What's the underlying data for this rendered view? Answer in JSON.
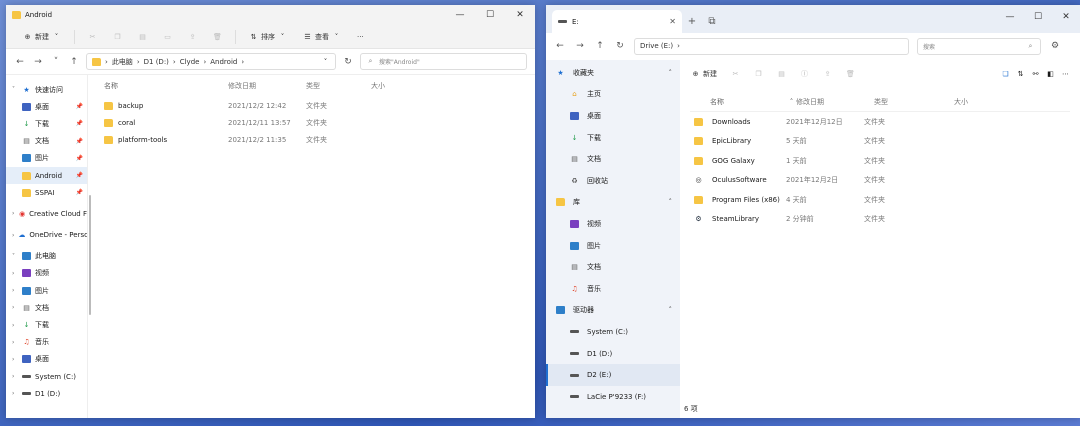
{
  "colors": {
    "accent": "#1f6fd1",
    "folder": "#f6c544",
    "desktop": "#3f63c0"
  },
  "left": {
    "title": "Android",
    "commands": {
      "new": "新建",
      "sort": "排序",
      "view": "查看",
      "more": "···"
    },
    "breadcrumb": [
      "此电脑",
      "D1 (D:)",
      "Clyde",
      "Android"
    ],
    "search_placeholder": "搜索\"Android\"",
    "columns": {
      "name": "名称",
      "date": "修改日期",
      "type": "类型",
      "size": "大小"
    },
    "files": [
      {
        "name": "backup",
        "date": "2021/12/2 12:42",
        "type": "文件夹"
      },
      {
        "name": "coral",
        "date": "2021/12/11 13:57",
        "type": "文件夹"
      },
      {
        "name": "platform-tools",
        "date": "2021/12/2 11:35",
        "type": "文件夹"
      }
    ],
    "nav": [
      {
        "label": "快速访问",
        "icon": "star-icon",
        "chev": "˅",
        "pin": ""
      },
      {
        "label": "桌面",
        "icon": "desktop-icon",
        "chev": "",
        "pin": "📌"
      },
      {
        "label": "下载",
        "icon": "download-icon",
        "chev": "",
        "pin": "📌"
      },
      {
        "label": "文档",
        "icon": "document-icon",
        "chev": "",
        "pin": "📌"
      },
      {
        "label": "图片",
        "icon": "pictures-icon",
        "chev": "",
        "pin": "📌"
      },
      {
        "label": "Android",
        "icon": "folder-icon",
        "chev": "",
        "pin": "📌"
      },
      {
        "label": "SSPAI",
        "icon": "folder-icon",
        "chev": "",
        "pin": "📌"
      },
      {
        "label": "Creative Cloud F",
        "icon": "creative-cloud-icon",
        "chev": "›",
        "pin": ""
      },
      {
        "label": "OneDrive - Perso",
        "icon": "onedrive-icon",
        "chev": "›",
        "pin": ""
      },
      {
        "label": "此电脑",
        "icon": "computer-icon",
        "chev": "˅",
        "pin": ""
      },
      {
        "label": "视频",
        "icon": "videos-icon",
        "chev": "›",
        "pin": ""
      },
      {
        "label": "图片",
        "icon": "pictures-icon",
        "chev": "›",
        "pin": ""
      },
      {
        "label": "文档",
        "icon": "document-icon",
        "chev": "›",
        "pin": ""
      },
      {
        "label": "下载",
        "icon": "download-icon",
        "chev": "›",
        "pin": ""
      },
      {
        "label": "音乐",
        "icon": "music-icon",
        "chev": "›",
        "pin": ""
      },
      {
        "label": "桌面",
        "icon": "desktop-icon",
        "chev": "›",
        "pin": ""
      },
      {
        "label": "System (C:)",
        "icon": "drive-icon",
        "chev": "›",
        "pin": ""
      },
      {
        "label": "D1 (D:)",
        "icon": "drive-icon",
        "chev": "›",
        "pin": ""
      }
    ]
  },
  "right": {
    "tab_title": "E:",
    "address": "Drive (E:)",
    "search_placeholder": "搜索",
    "new_label": "新建",
    "columns": {
      "name": "名称",
      "date": "修改日期",
      "type": "类型",
      "size": "大小"
    },
    "files": [
      {
        "name": "Downloads",
        "date": "2021年12月12日",
        "type": "文件夹",
        "icon": "folder-icon"
      },
      {
        "name": "EpicLibrary",
        "date": "5 天前",
        "type": "文件夹",
        "icon": "folder-icon"
      },
      {
        "name": "GOG Galaxy",
        "date": "1 天前",
        "type": "文件夹",
        "icon": "folder-icon"
      },
      {
        "name": "OculusSoftware",
        "date": "2021年12月2日",
        "type": "文件夹",
        "icon": "oculus-icon"
      },
      {
        "name": "Program Files (x86)",
        "date": "4 天前",
        "type": "文件夹",
        "icon": "folder-icon"
      },
      {
        "name": "SteamLibrary",
        "date": "2 分钟前",
        "type": "文件夹",
        "icon": "steam-icon"
      }
    ],
    "status": "6 项",
    "nav": {
      "favorites": {
        "label": "收藏夹",
        "items": [
          "主页",
          "桌面",
          "下载",
          "文档",
          "回收站"
        ]
      },
      "library": {
        "label": "库",
        "items": [
          "视频",
          "图片",
          "文档",
          "音乐"
        ]
      },
      "drives": {
        "label": "驱动器",
        "items": [
          "System (C:)",
          "D1 (D:)",
          "D2 (E:)",
          "LaCie P'9233 (F:)"
        ]
      }
    }
  }
}
